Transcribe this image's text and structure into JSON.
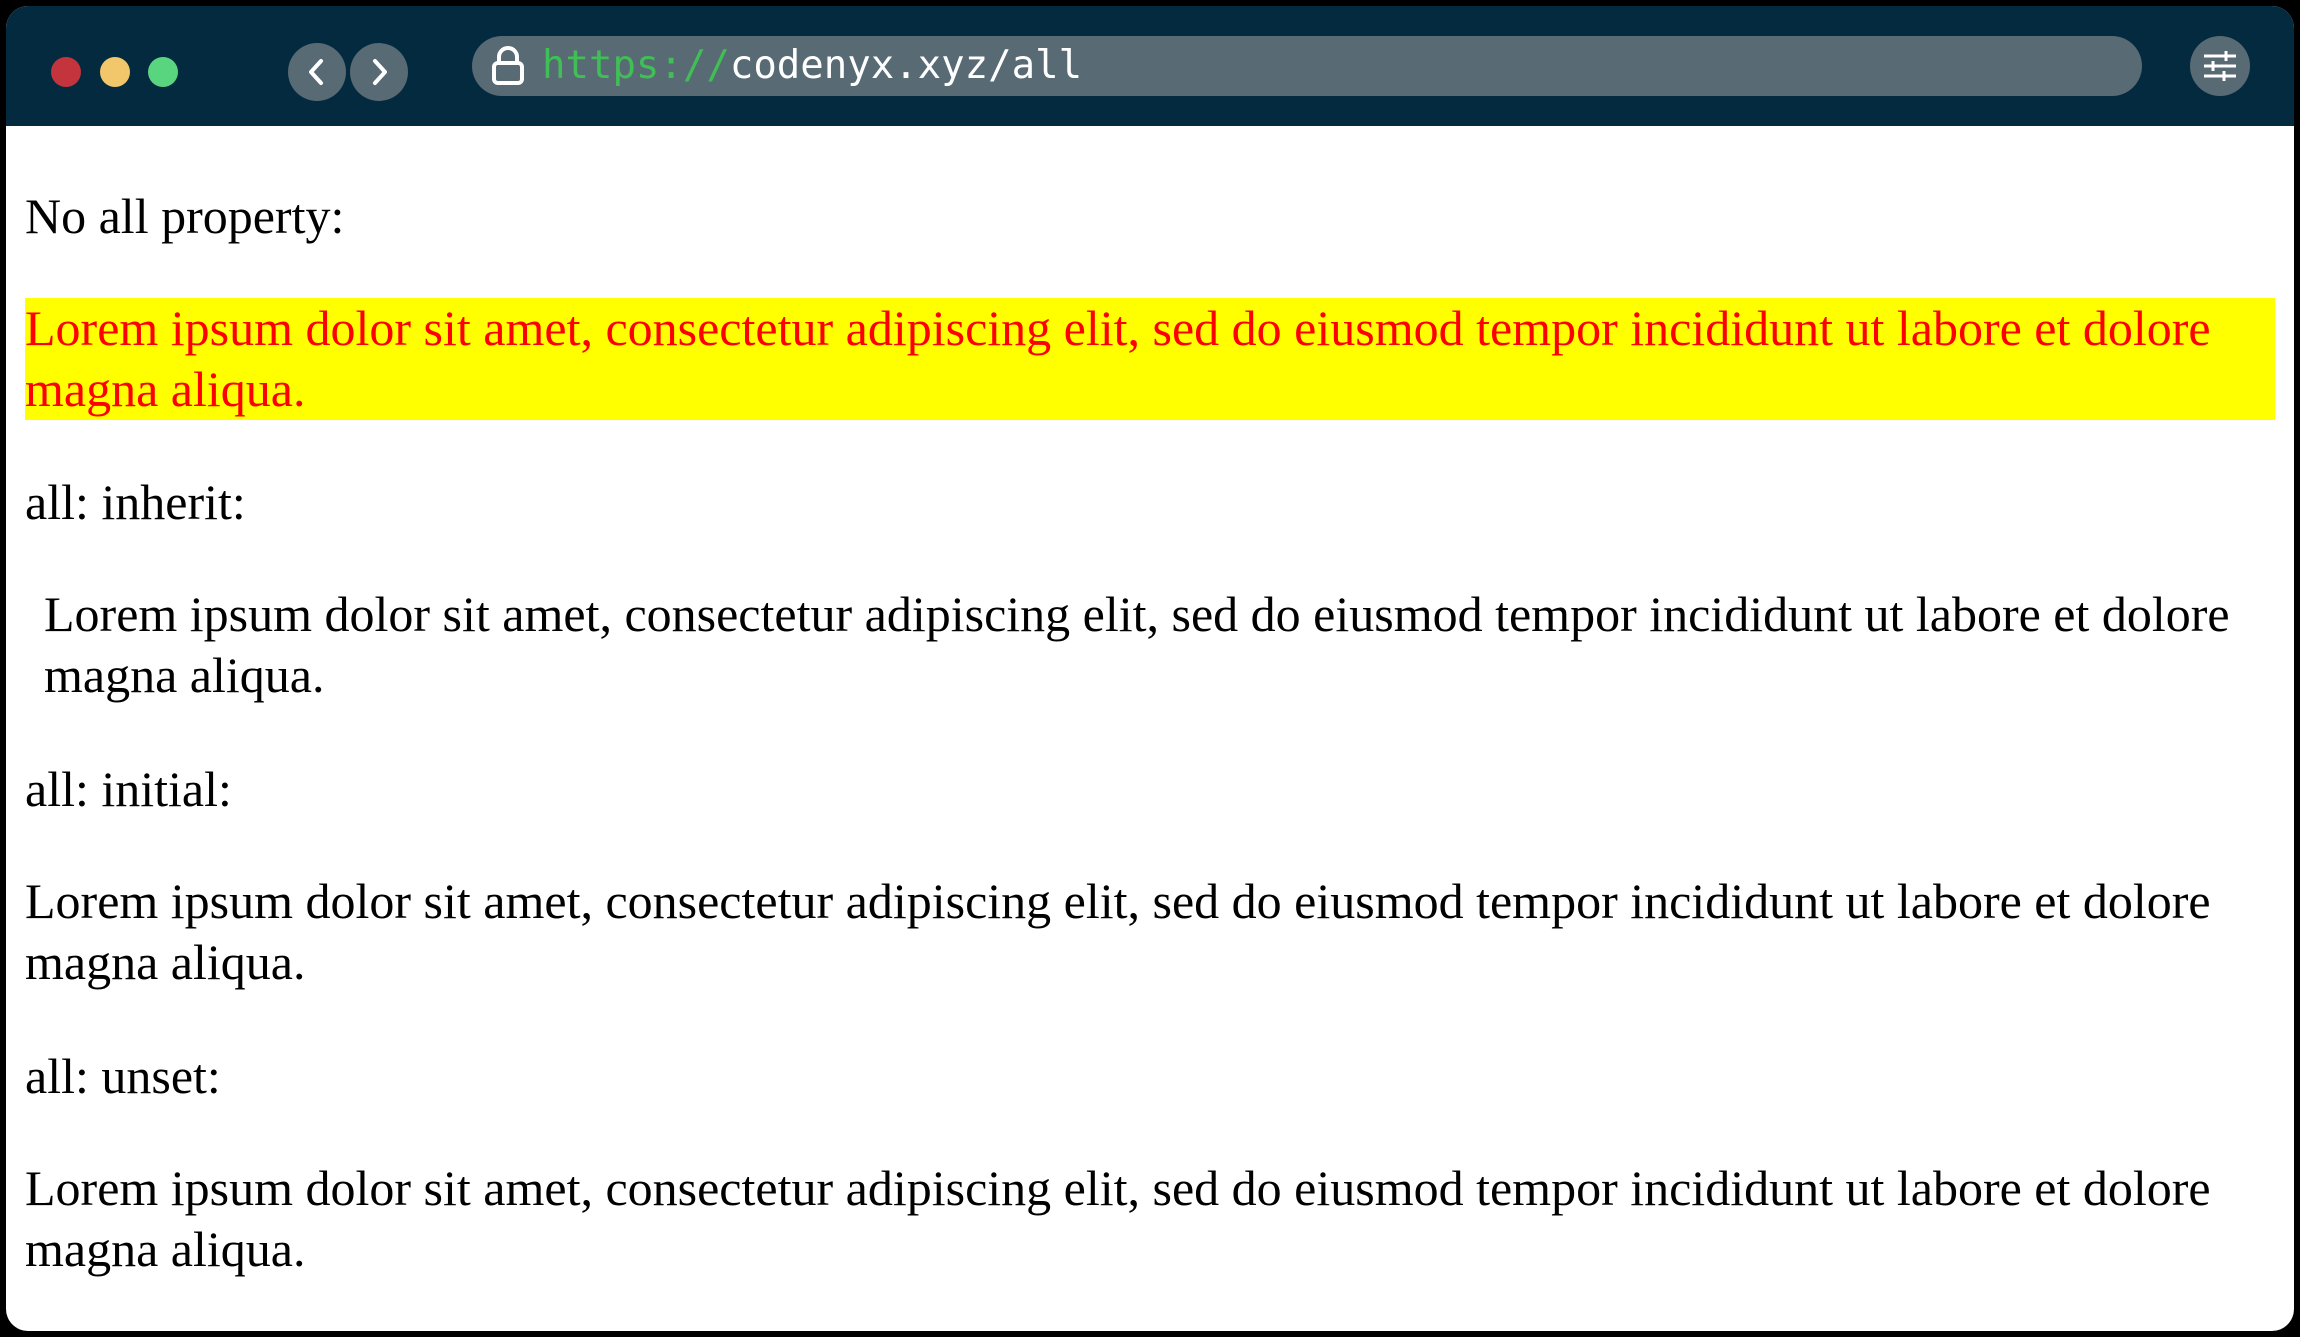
{
  "browser": {
    "url_scheme": "https://",
    "url_host": "codenyx.xyz/all",
    "controls": {
      "close_color": "#c4343c",
      "minimize_color": "#f2c66a",
      "maximize_color": "#5ad57f"
    }
  },
  "page": {
    "sections": [
      {
        "heading": "No all property:",
        "paragraph": "Lorem ipsum dolor sit amet, consectetur adipiscing elit, sed do eiusmod tempor incididunt ut labore et dolore magna aliqua.",
        "background": "#ffff00",
        "text_color": "#ff0000"
      },
      {
        "heading": "all: inherit:",
        "paragraph": "Lorem ipsum dolor sit amet, consectetur adipiscing elit, sed do eiusmod tempor incididunt ut labore et dolore magna aliqua."
      },
      {
        "heading": "all: initial:",
        "paragraph": "Lorem ipsum dolor sit amet, consectetur adipiscing elit, sed do eiusmod tempor incididunt ut labore et dolore magna aliqua."
      },
      {
        "heading": "all: unset:",
        "paragraph": "Lorem ipsum dolor sit amet, consectetur adipiscing elit, sed do eiusmod tempor incididunt ut labore et dolore magna aliqua."
      }
    ]
  },
  "icons": {
    "back": "chevron-left-icon",
    "forward": "chevron-right-icon",
    "lock": "lock-icon",
    "menu": "sliders-icon"
  }
}
